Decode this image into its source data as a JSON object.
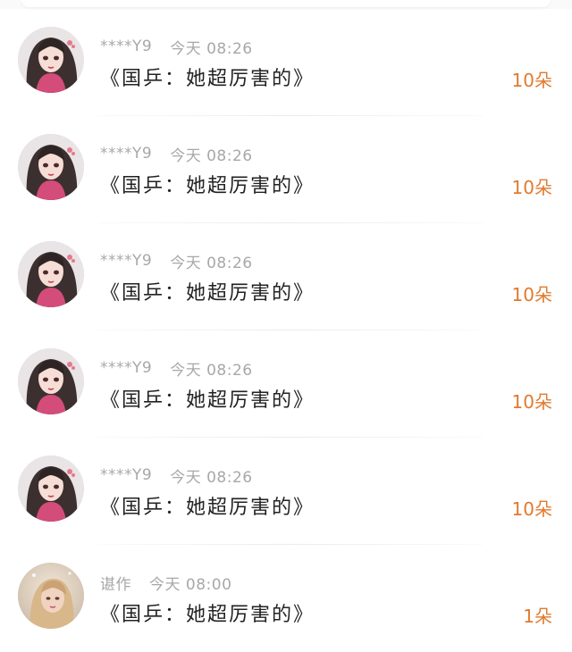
{
  "gifts": [
    {
      "user": "****Y9",
      "time": "今天 08:26",
      "title": "《国乒：她超厉害的》",
      "count": "10朵",
      "avatar_type": "cartoon"
    },
    {
      "user": "****Y9",
      "time": "今天 08:26",
      "title": "《国乒：她超厉害的》",
      "count": "10朵",
      "avatar_type": "cartoon"
    },
    {
      "user": "****Y9",
      "time": "今天 08:26",
      "title": "《国乒：她超厉害的》",
      "count": "10朵",
      "avatar_type": "cartoon"
    },
    {
      "user": "****Y9",
      "time": "今天 08:26",
      "title": "《国乒：她超厉害的》",
      "count": "10朵",
      "avatar_type": "cartoon"
    },
    {
      "user": "****Y9",
      "time": "今天 08:26",
      "title": "《国乒：她超厉害的》",
      "count": "10朵",
      "avatar_type": "cartoon"
    },
    {
      "user": "谌作",
      "time": "今天 08:00",
      "title": "《国乒：她超厉害的》",
      "count": "1朵",
      "avatar_type": "photo"
    }
  ],
  "colors": {
    "count": "#e07a2e",
    "meta": "#a8a8a8",
    "title": "#222222"
  }
}
